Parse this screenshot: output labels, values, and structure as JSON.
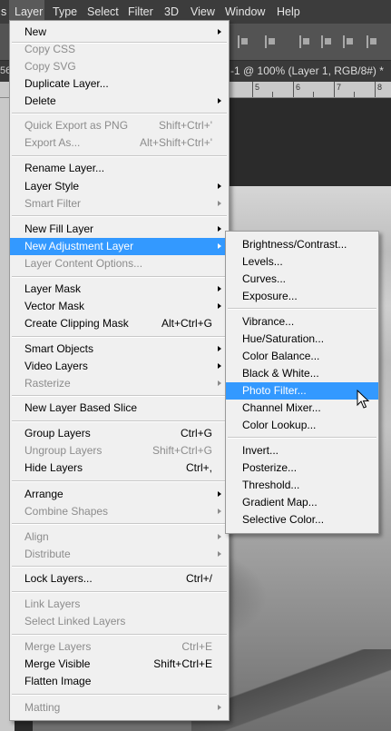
{
  "menubar": {
    "ps_logo": "s",
    "items": [
      "Layer",
      "Type",
      "Select",
      "Filter",
      "3D",
      "View",
      "Window",
      "Help"
    ]
  },
  "document": {
    "tab_title": "-1 @ 100% (Layer 1, RGB/8#) *",
    "left_edge_label": "56",
    "ruler_numbers": [
      "5",
      "6",
      "7",
      "8"
    ]
  },
  "layer_menu": {
    "items": [
      {
        "label": "New",
        "shortcut": "",
        "submenu": true,
        "disabled": false
      },
      {
        "label": "Copy CSS",
        "shortcut": "",
        "submenu": false,
        "disabled": true
      },
      {
        "label": "Copy SVG",
        "shortcut": "",
        "submenu": false,
        "disabled": true
      },
      {
        "label": "Duplicate Layer...",
        "shortcut": "",
        "submenu": false,
        "disabled": false
      },
      {
        "label": "Delete",
        "shortcut": "",
        "submenu": true,
        "disabled": false
      },
      {
        "label": "Quick Export as PNG",
        "shortcut": "Shift+Ctrl+'",
        "submenu": false,
        "disabled": true
      },
      {
        "label": "Export As...",
        "shortcut": "Alt+Shift+Ctrl+'",
        "submenu": false,
        "disabled": true
      },
      {
        "label": "Rename Layer...",
        "shortcut": "",
        "submenu": false,
        "disabled": false
      },
      {
        "label": "Layer Style",
        "shortcut": "",
        "submenu": true,
        "disabled": false
      },
      {
        "label": "Smart Filter",
        "shortcut": "",
        "submenu": true,
        "disabled": true
      },
      {
        "label": "New Fill Layer",
        "shortcut": "",
        "submenu": true,
        "disabled": false
      },
      {
        "label": "New Adjustment Layer",
        "shortcut": "",
        "submenu": true,
        "disabled": false,
        "highlighted": true
      },
      {
        "label": "Layer Content Options...",
        "shortcut": "",
        "submenu": false,
        "disabled": true
      },
      {
        "label": "Layer Mask",
        "shortcut": "",
        "submenu": true,
        "disabled": false
      },
      {
        "label": "Vector Mask",
        "shortcut": "",
        "submenu": true,
        "disabled": false
      },
      {
        "label": "Create Clipping Mask",
        "shortcut": "Alt+Ctrl+G",
        "submenu": false,
        "disabled": false
      },
      {
        "label": "Smart Objects",
        "shortcut": "",
        "submenu": true,
        "disabled": false
      },
      {
        "label": "Video Layers",
        "shortcut": "",
        "submenu": true,
        "disabled": false
      },
      {
        "label": "Rasterize",
        "shortcut": "",
        "submenu": true,
        "disabled": true
      },
      {
        "label": "New Layer Based Slice",
        "shortcut": "",
        "submenu": false,
        "disabled": false
      },
      {
        "label": "Group Layers",
        "shortcut": "Ctrl+G",
        "submenu": false,
        "disabled": false
      },
      {
        "label": "Ungroup Layers",
        "shortcut": "Shift+Ctrl+G",
        "submenu": false,
        "disabled": true
      },
      {
        "label": "Hide Layers",
        "shortcut": "Ctrl+,",
        "submenu": false,
        "disabled": false
      },
      {
        "label": "Arrange",
        "shortcut": "",
        "submenu": true,
        "disabled": false
      },
      {
        "label": "Combine Shapes",
        "shortcut": "",
        "submenu": true,
        "disabled": true
      },
      {
        "label": "Align",
        "shortcut": "",
        "submenu": true,
        "disabled": true
      },
      {
        "label": "Distribute",
        "shortcut": "",
        "submenu": true,
        "disabled": true
      },
      {
        "label": "Lock Layers...",
        "shortcut": "Ctrl+/",
        "submenu": false,
        "disabled": false
      },
      {
        "label": "Link Layers",
        "shortcut": "",
        "submenu": false,
        "disabled": true
      },
      {
        "label": "Select Linked Layers",
        "shortcut": "",
        "submenu": false,
        "disabled": true
      },
      {
        "label": "Merge Layers",
        "shortcut": "Ctrl+E",
        "submenu": false,
        "disabled": true
      },
      {
        "label": "Merge Visible",
        "shortcut": "Shift+Ctrl+E",
        "submenu": false,
        "disabled": false
      },
      {
        "label": "Flatten Image",
        "shortcut": "",
        "submenu": false,
        "disabled": false
      },
      {
        "label": "Matting",
        "shortcut": "",
        "submenu": true,
        "disabled": true
      }
    ]
  },
  "adjustment_submenu": {
    "items": [
      {
        "label": "Brightness/Contrast..."
      },
      {
        "label": "Levels..."
      },
      {
        "label": "Curves..."
      },
      {
        "label": "Exposure..."
      },
      {
        "label": "Vibrance..."
      },
      {
        "label": "Hue/Saturation..."
      },
      {
        "label": "Color Balance..."
      },
      {
        "label": "Black & White..."
      },
      {
        "label": "Photo Filter...",
        "highlighted": true
      },
      {
        "label": "Channel Mixer..."
      },
      {
        "label": "Color Lookup..."
      },
      {
        "label": "Invert..."
      },
      {
        "label": "Posterize..."
      },
      {
        "label": "Threshold..."
      },
      {
        "label": "Gradient Map..."
      },
      {
        "label": "Selective Color..."
      }
    ]
  },
  "colors": {
    "highlight": "#3399ff",
    "menu_bg": "#f0f0f0",
    "disabled_text": "#8c8c8c"
  },
  "icons": [
    "align-edges-icon",
    "submenu-arrow-icon",
    "mouse-pointer-icon"
  ]
}
